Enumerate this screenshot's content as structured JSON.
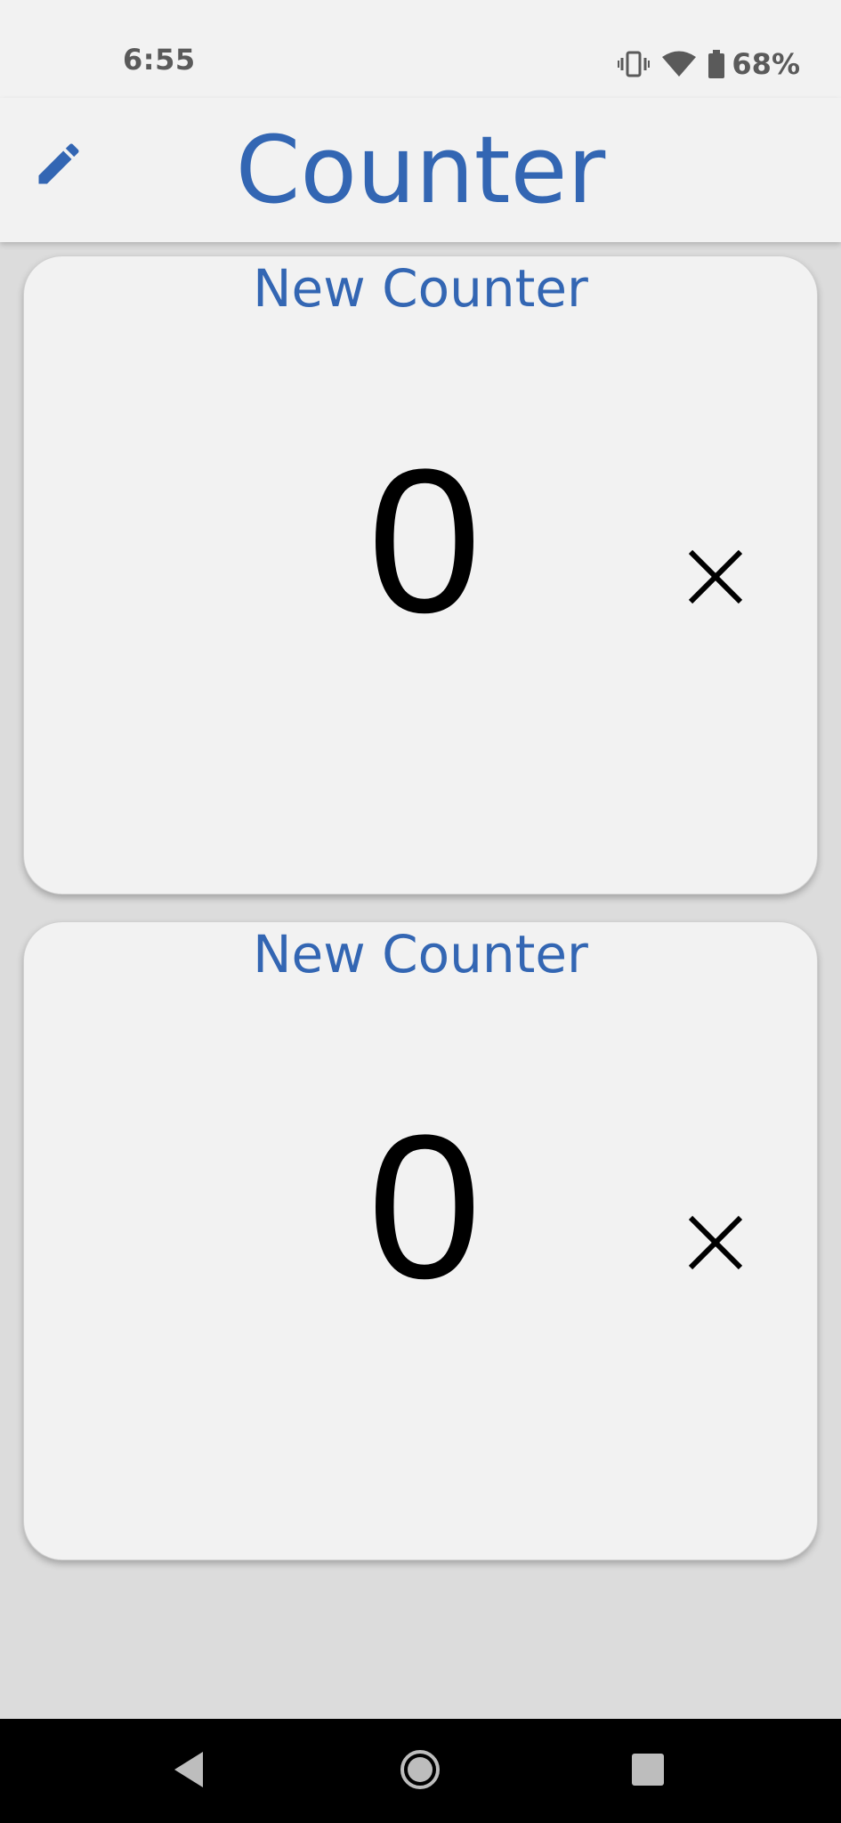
{
  "status_bar": {
    "time": "6:55",
    "battery_percent": "68%",
    "icons": [
      "vibrate-icon",
      "wifi-icon",
      "battery-icon"
    ]
  },
  "app_bar": {
    "title": "Counter",
    "edit_icon": "pencil-icon"
  },
  "counters": [
    {
      "name": "New Counter",
      "value": "0",
      "close_icon": "close-icon"
    },
    {
      "name": "New Counter",
      "value": "0",
      "close_icon": "close-icon"
    }
  ],
  "nav_bar": {
    "icons": [
      "back-icon",
      "home-icon",
      "recents-icon"
    ]
  },
  "colors": {
    "accent": "#3366b3",
    "surface": "#f2f2f2",
    "background": "#dcdcdc",
    "status_text": "#5a5a5a"
  }
}
